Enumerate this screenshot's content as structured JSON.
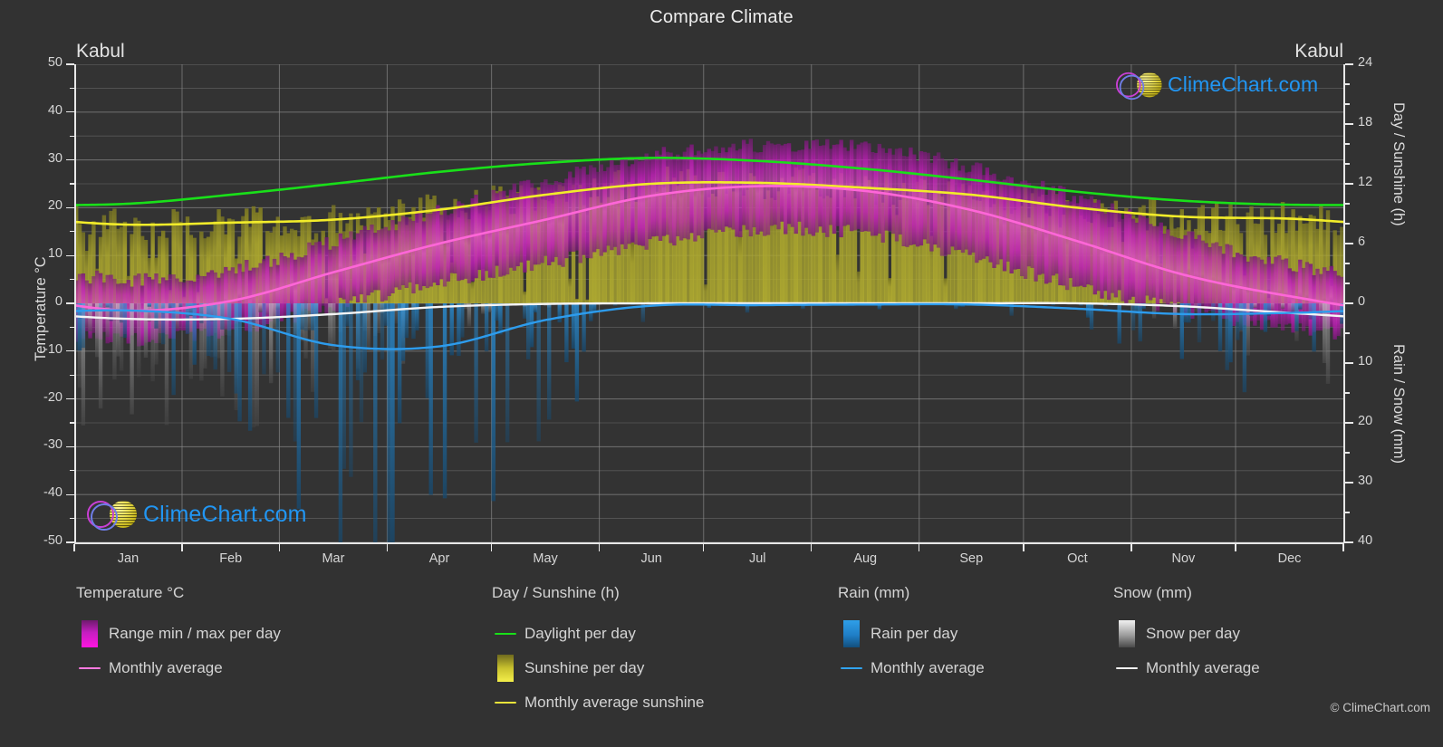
{
  "title": "Compare Climate",
  "location_left": "Kabul",
  "location_right": "Kabul",
  "copyright": "© ClimeChart.com",
  "watermark": {
    "text": "ClimeChart.com"
  },
  "axes": {
    "left_title": "Temperature °C",
    "right_top_title": "Day / Sunshine (h)",
    "right_bottom_title": "Rain / Snow (mm)",
    "left_ticks": [
      "50",
      "40",
      "30",
      "20",
      "10",
      "0",
      "-10",
      "-20",
      "-30",
      "-40",
      "-50"
    ],
    "right_top_ticks": [
      "24",
      "18",
      "12",
      "6",
      "0"
    ],
    "right_bottom_ticks": [
      "0",
      "10",
      "20",
      "30",
      "40"
    ],
    "month_labels": [
      "Jan",
      "Feb",
      "Mar",
      "Apr",
      "May",
      "Jun",
      "Jul",
      "Aug",
      "Sep",
      "Oct",
      "Nov",
      "Dec"
    ]
  },
  "legend": {
    "columns": [
      {
        "heading": "Temperature °C",
        "items": [
          {
            "label": "Range min / max per day",
            "marker": "swatch",
            "color": "#ff00dd"
          },
          {
            "label": "Monthly average",
            "marker": "line",
            "color": "#ff7ae0"
          }
        ]
      },
      {
        "heading": "Day / Sunshine (h)",
        "items": [
          {
            "label": "Daylight per day",
            "marker": "line",
            "color": "#19e019"
          },
          {
            "label": "Sunshine per day",
            "marker": "swatch",
            "color": "#f0ec3c"
          },
          {
            "label": "Monthly average sunshine",
            "marker": "line",
            "color": "#e8e43a"
          }
        ]
      },
      {
        "heading": "Rain (mm)",
        "items": [
          {
            "label": "Rain per day",
            "marker": "swatch",
            "color": "#1f8fe0"
          },
          {
            "label": "Monthly average",
            "marker": "line",
            "color": "#31a3ef"
          }
        ]
      },
      {
        "heading": "Snow (mm)",
        "items": [
          {
            "label": "Snow per day",
            "marker": "swatch",
            "color": "#e6e6e6"
          },
          {
            "label": "Monthly average",
            "marker": "line",
            "color": "#f2f2f2"
          }
        ]
      }
    ]
  },
  "colors": {
    "background": "#323232",
    "plot_background": "#333333",
    "grid": "#8a8a8a",
    "daylight": "#19e019",
    "sunshine_avg": "#f2ec2a",
    "sunshine_band": "#a8a32c",
    "temp_range": "#cc22bb",
    "temp_avg": "#ff66d8",
    "rain": "#1f7fc4",
    "rain_avg": "#2d9ced",
    "snow": "#9a9a9a",
    "snow_avg": "#f5f5f5",
    "text": "#d6d6d6"
  },
  "chart_data": {
    "type": "line",
    "title": "Compare Climate",
    "subtitle": "Kabul",
    "xlabel": "",
    "ylabel": "Temperature °C",
    "ylim": [
      -50,
      50
    ],
    "y2_top": {
      "label": "Day / Sunshine (h)",
      "lim": [
        0,
        24
      ]
    },
    "y2_bottom": {
      "label": "Rain / Snow (mm)",
      "lim": [
        0,
        40
      ]
    },
    "grid": true,
    "legend_position": "below",
    "categories": [
      "Jan",
      "Feb",
      "Mar",
      "Apr",
      "May",
      "Jun",
      "Jul",
      "Aug",
      "Sep",
      "Oct",
      "Nov",
      "Dec"
    ],
    "series": [
      {
        "name": "Daylight per day",
        "unit": "h",
        "axis": "right_top",
        "color": "#19e019",
        "values": [
          10.0,
          10.9,
          12.0,
          13.2,
          14.1,
          14.6,
          14.3,
          13.5,
          12.4,
          11.2,
          10.3,
          9.9
        ]
      },
      {
        "name": "Monthly average sunshine",
        "unit": "h",
        "axis": "right_top",
        "color": "#f2ec2a",
        "values": [
          7.9,
          8.1,
          8.4,
          9.4,
          10.9,
          12.0,
          12.1,
          11.6,
          10.9,
          9.6,
          8.7,
          8.5
        ]
      },
      {
        "name": "Monthly average temperature",
        "unit": "°C",
        "axis": "left",
        "color": "#ff66d8",
        "values": [
          -1.5,
          0.5,
          6.5,
          12.5,
          17.5,
          22.5,
          24.5,
          23.5,
          19.5,
          13.0,
          6.0,
          1.5
        ]
      },
      {
        "name": "Monthly average rain",
        "unit": "mm",
        "axis": "right_bottom",
        "color": "#2d9ced",
        "values": [
          1.2,
          2.6,
          7.0,
          7.2,
          2.8,
          0.4,
          0.3,
          0.2,
          0.2,
          0.9,
          1.8,
          1.6
        ]
      },
      {
        "name": "Monthly average snow",
        "unit": "mm",
        "axis": "right_bottom",
        "color": "#f5f5f5",
        "values": [
          2.6,
          2.6,
          1.8,
          0.6,
          0.1,
          0.0,
          0.0,
          0.0,
          0.0,
          0.0,
          0.5,
          1.6
        ]
      },
      {
        "name": "Daily max temperature",
        "unit": "°C",
        "axis": "left",
        "color": "#cc22bb",
        "values": [
          5.0,
          7.0,
          13.0,
          19.5,
          25.5,
          31.0,
          33.0,
          32.5,
          28.5,
          22.0,
          14.0,
          8.0
        ]
      },
      {
        "name": "Daily min temperature",
        "unit": "°C",
        "axis": "left",
        "color": "#cc22bb",
        "values": [
          -7.5,
          -5.5,
          -0.5,
          4.5,
          8.5,
          12.5,
          15.5,
          14.5,
          9.5,
          3.5,
          -1.5,
          -5.0
        ]
      }
    ],
    "annotations": [
      "Range min / max per day shown as magenta band",
      "Sunshine per day shown as yellow band",
      "Rain and snow per day shown as downward bars"
    ]
  }
}
